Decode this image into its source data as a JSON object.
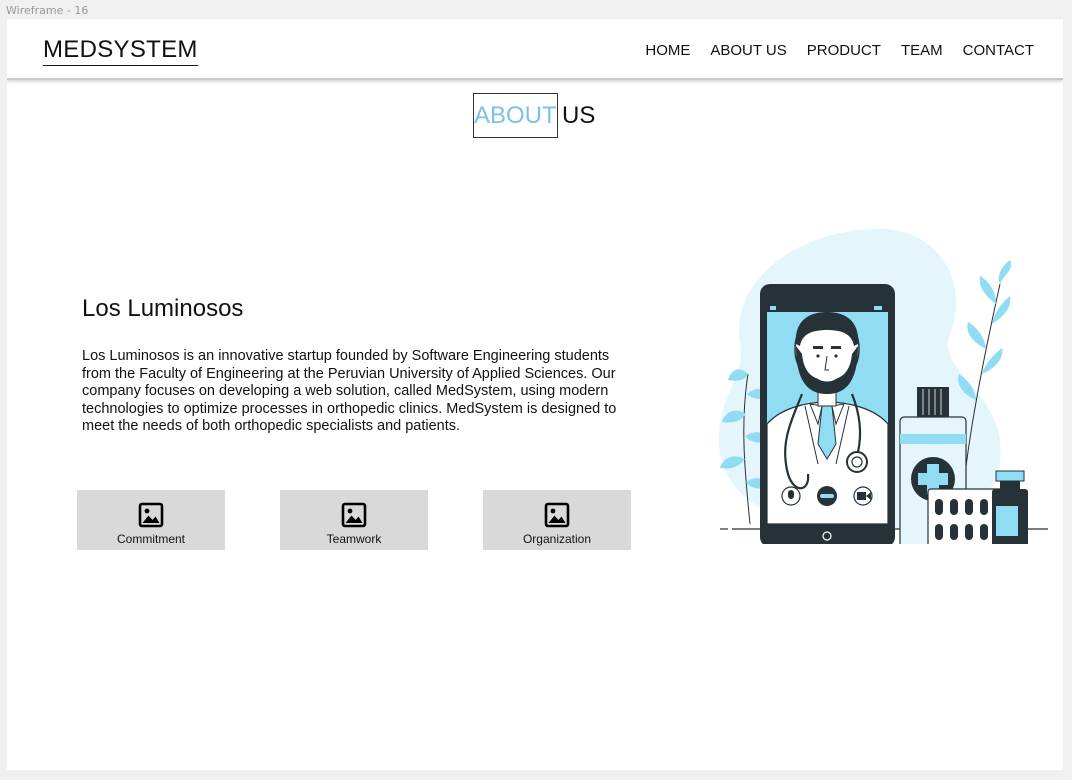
{
  "frame": {
    "label": "Wireframe - 16"
  },
  "header": {
    "logo": "MEDSYSTEM",
    "nav": [
      "HOME",
      "ABOUT US",
      "PRODUCT",
      "TEAM",
      "CONTACT"
    ]
  },
  "section": {
    "title_highlight": "ABOUT",
    "title_rest": "US"
  },
  "about": {
    "name": "Los Luminosos",
    "description": "Los Luminosos is an innovative startup founded by Software Engineering students from the Faculty of Engineering at the Peruvian University of Applied Sciences. Our company focuses on developing a web solution, called MedSystem, using modern technologies to optimize processes in orthopedic clinics. MedSystem is designed to meet the needs of both orthopedic specialists and patients."
  },
  "values": [
    {
      "label": "Commitment",
      "icon": "image-icon"
    },
    {
      "label": "Teamwork",
      "icon": "image-icon"
    },
    {
      "label": "Organization",
      "icon": "image-icon"
    }
  ],
  "colors": {
    "accent": "#7cc0ee",
    "illustration_light": "#e4f6fc",
    "illustration_blue": "#8fdcf3",
    "illustration_dark": "#263238",
    "card_bg": "#d9d9d9"
  }
}
